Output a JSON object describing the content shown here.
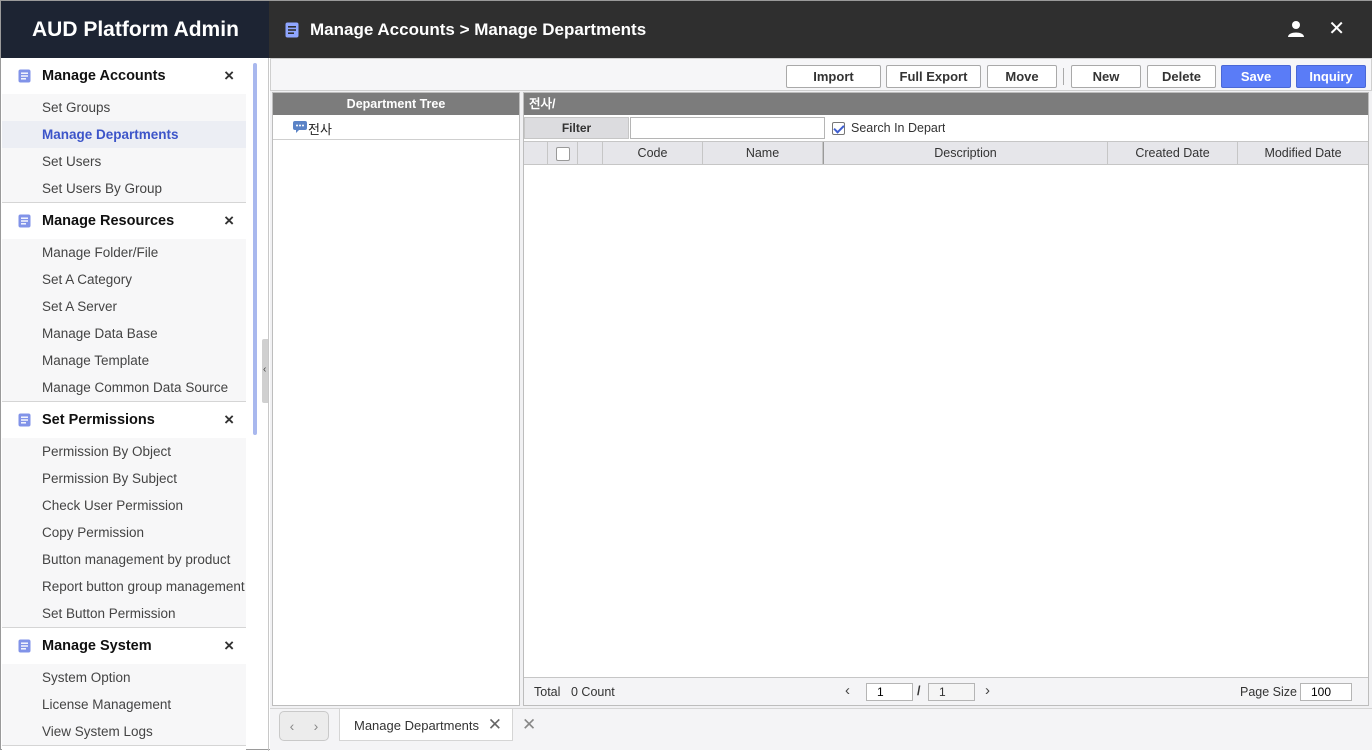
{
  "app": {
    "title": "AUD Platform Admin"
  },
  "header": {
    "breadcrumb": "Manage Accounts > Manage Departments",
    "icons": {
      "doc": "document-icon",
      "user": "user-icon",
      "close": "close-icon"
    }
  },
  "sidebar": {
    "sections": [
      {
        "title": "Manage Accounts",
        "items": [
          "Set Groups",
          "Manage Departments",
          "Set Users",
          "Set Users By Group"
        ]
      },
      {
        "title": "Manage Resources",
        "items": [
          "Manage Folder/File",
          "Set A Category",
          "Set A Server",
          "Manage Data Base",
          "Manage Template",
          "Manage Common Data Source"
        ]
      },
      {
        "title": "Set Permissions",
        "items": [
          "Permission By Object",
          "Permission By Subject",
          "Check User Permission",
          "Copy Permission",
          "Button management by product",
          "Report button group management",
          "Set Button Permission"
        ]
      },
      {
        "title": "Manage System",
        "items": [
          "System Option",
          "License Management",
          "View System Logs"
        ]
      }
    ],
    "active_item": "Manage Departments"
  },
  "toolbar": {
    "import": "Import",
    "full_export": "Full Export",
    "move": "Move",
    "new": "New",
    "delete": "Delete",
    "save": "Save",
    "inquiry": "Inquiry"
  },
  "tree": {
    "header": "Department Tree",
    "nodes": [
      "전사"
    ]
  },
  "grid": {
    "path": "전사/",
    "filter_label": "Filter",
    "filter_value": "",
    "search_in_dept_label": "Search In Depart",
    "search_in_dept_checked": true,
    "columns": [
      "Code",
      "Name",
      "Description",
      "Created Date",
      "Modified Date"
    ],
    "rows": [],
    "footer": {
      "total_label": "Total",
      "count_text": "0 Count",
      "current_page": "1",
      "separator": "/",
      "total_pages": "1",
      "page_size_label": "Page Size",
      "page_size": "100"
    }
  },
  "tabs": {
    "open": [
      "Manage Departments"
    ]
  },
  "colors": {
    "accent": "#5a7cf7",
    "active_text": "#3d55c9",
    "header_bg": "#2f2f2f",
    "brand_bg": "#1d2433"
  }
}
